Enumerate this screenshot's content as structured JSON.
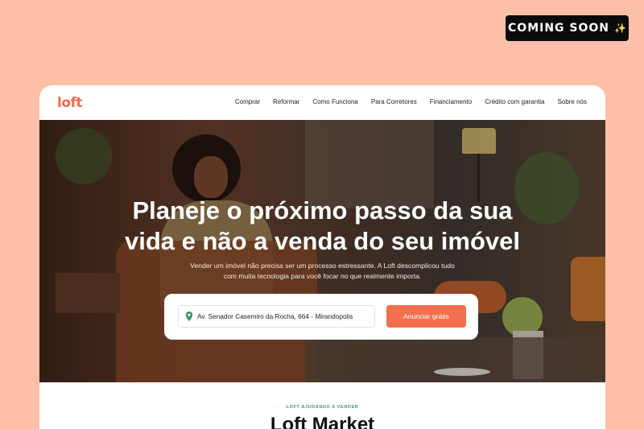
{
  "badge": {
    "label": "COMING SOON",
    "icon": "sparkle-icon",
    "icon_glyph": "✨"
  },
  "brand": {
    "logo_text": "loft",
    "accent": "#f3704f"
  },
  "nav": {
    "items": [
      "Comprar",
      "Reformar",
      "Como Funciona",
      "Para Corretores",
      "Financiamento",
      "Crédito com garantia",
      "Sobre nós"
    ]
  },
  "hero": {
    "headline_line1": "Planeje o próximo passo da sua",
    "headline_line2": "vida e não a venda do seu imóvel",
    "subtext_line1": "Vender um imóvel não precisa ser um processo estressante. A Loft descomplicou tudo",
    "subtext_line2": "com muita tecnologia para você focar no que realmente importa."
  },
  "search": {
    "address_value": "Av. Senador Casemiro da Rocha, 664 - Mirandopolis",
    "address_icon": "location-pin-icon",
    "cta_label": "Anunciar grátis"
  },
  "section": {
    "eyebrow": "LOFT AJUDANDO A VENDER",
    "title": "Loft Market"
  }
}
